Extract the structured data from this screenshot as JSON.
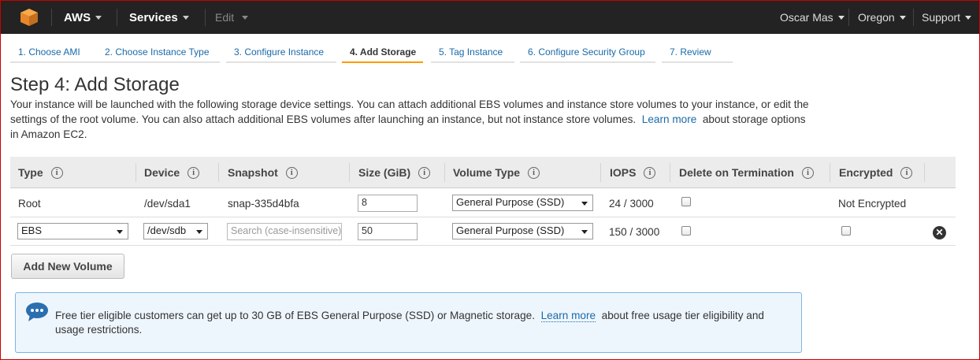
{
  "topnav": {
    "aws_label": "AWS",
    "services_label": "Services",
    "edit_label": "Edit",
    "user_label": "Oscar Mas",
    "region_label": "Oregon",
    "support_label": "Support"
  },
  "wizard": {
    "tabs": [
      {
        "label": "1. Choose AMI"
      },
      {
        "label": "2. Choose Instance Type"
      },
      {
        "label": "3. Configure Instance"
      },
      {
        "label": "4. Add Storage",
        "active": true
      },
      {
        "label": "5. Tag Instance"
      },
      {
        "label": "6. Configure Security Group"
      },
      {
        "label": "7. Review"
      }
    ]
  },
  "page": {
    "title": "Step 4: Add Storage",
    "description_part1": "Your instance will be launched with the following storage device settings. You can attach additional EBS volumes and instance store volumes to your instance, or edit the settings of the root volume. You can also attach additional EBS volumes after launching an instance, but not instance store volumes.",
    "learn_more": "Learn more",
    "description_part2": "about storage options in Amazon EC2."
  },
  "table": {
    "headers": [
      "Type",
      "Device",
      "Snapshot",
      "Size (GiB)",
      "Volume Type",
      "IOPS",
      "Delete on Termination",
      "Encrypted"
    ],
    "info_glyph": "i",
    "rows": [
      {
        "type": "Root",
        "device": "/dev/sda1",
        "snapshot": "snap-335d4bfa",
        "size": "8",
        "volume_type": "General Purpose (SSD)",
        "iops": "24 / 3000",
        "delete_on_termination": false,
        "encrypted": "Not Encrypted"
      },
      {
        "type": "EBS",
        "device": "/dev/sdb",
        "snapshot_placeholder": "Search (case-insensitive)",
        "size": "50",
        "volume_type": "General Purpose (SSD)",
        "iops": "150 / 3000",
        "delete_on_termination": false,
        "encrypted": false
      }
    ],
    "remove_glyph": "✕"
  },
  "actions": {
    "add_volume_label": "Add New Volume"
  },
  "notice": {
    "text_part1": "Free tier eligible customers can get up to 30 GB of EBS General Purpose (SSD) or Magnetic storage.",
    "learn_more": "Learn more",
    "text_part2": "about free usage tier eligibility and usage restrictions."
  },
  "colors": {
    "nav_bg": "#232323",
    "link": "#1a6aa8",
    "active_tab": "#ff9900",
    "notice_bg": "#eef6fd",
    "notice_border": "#7fb3e1"
  }
}
